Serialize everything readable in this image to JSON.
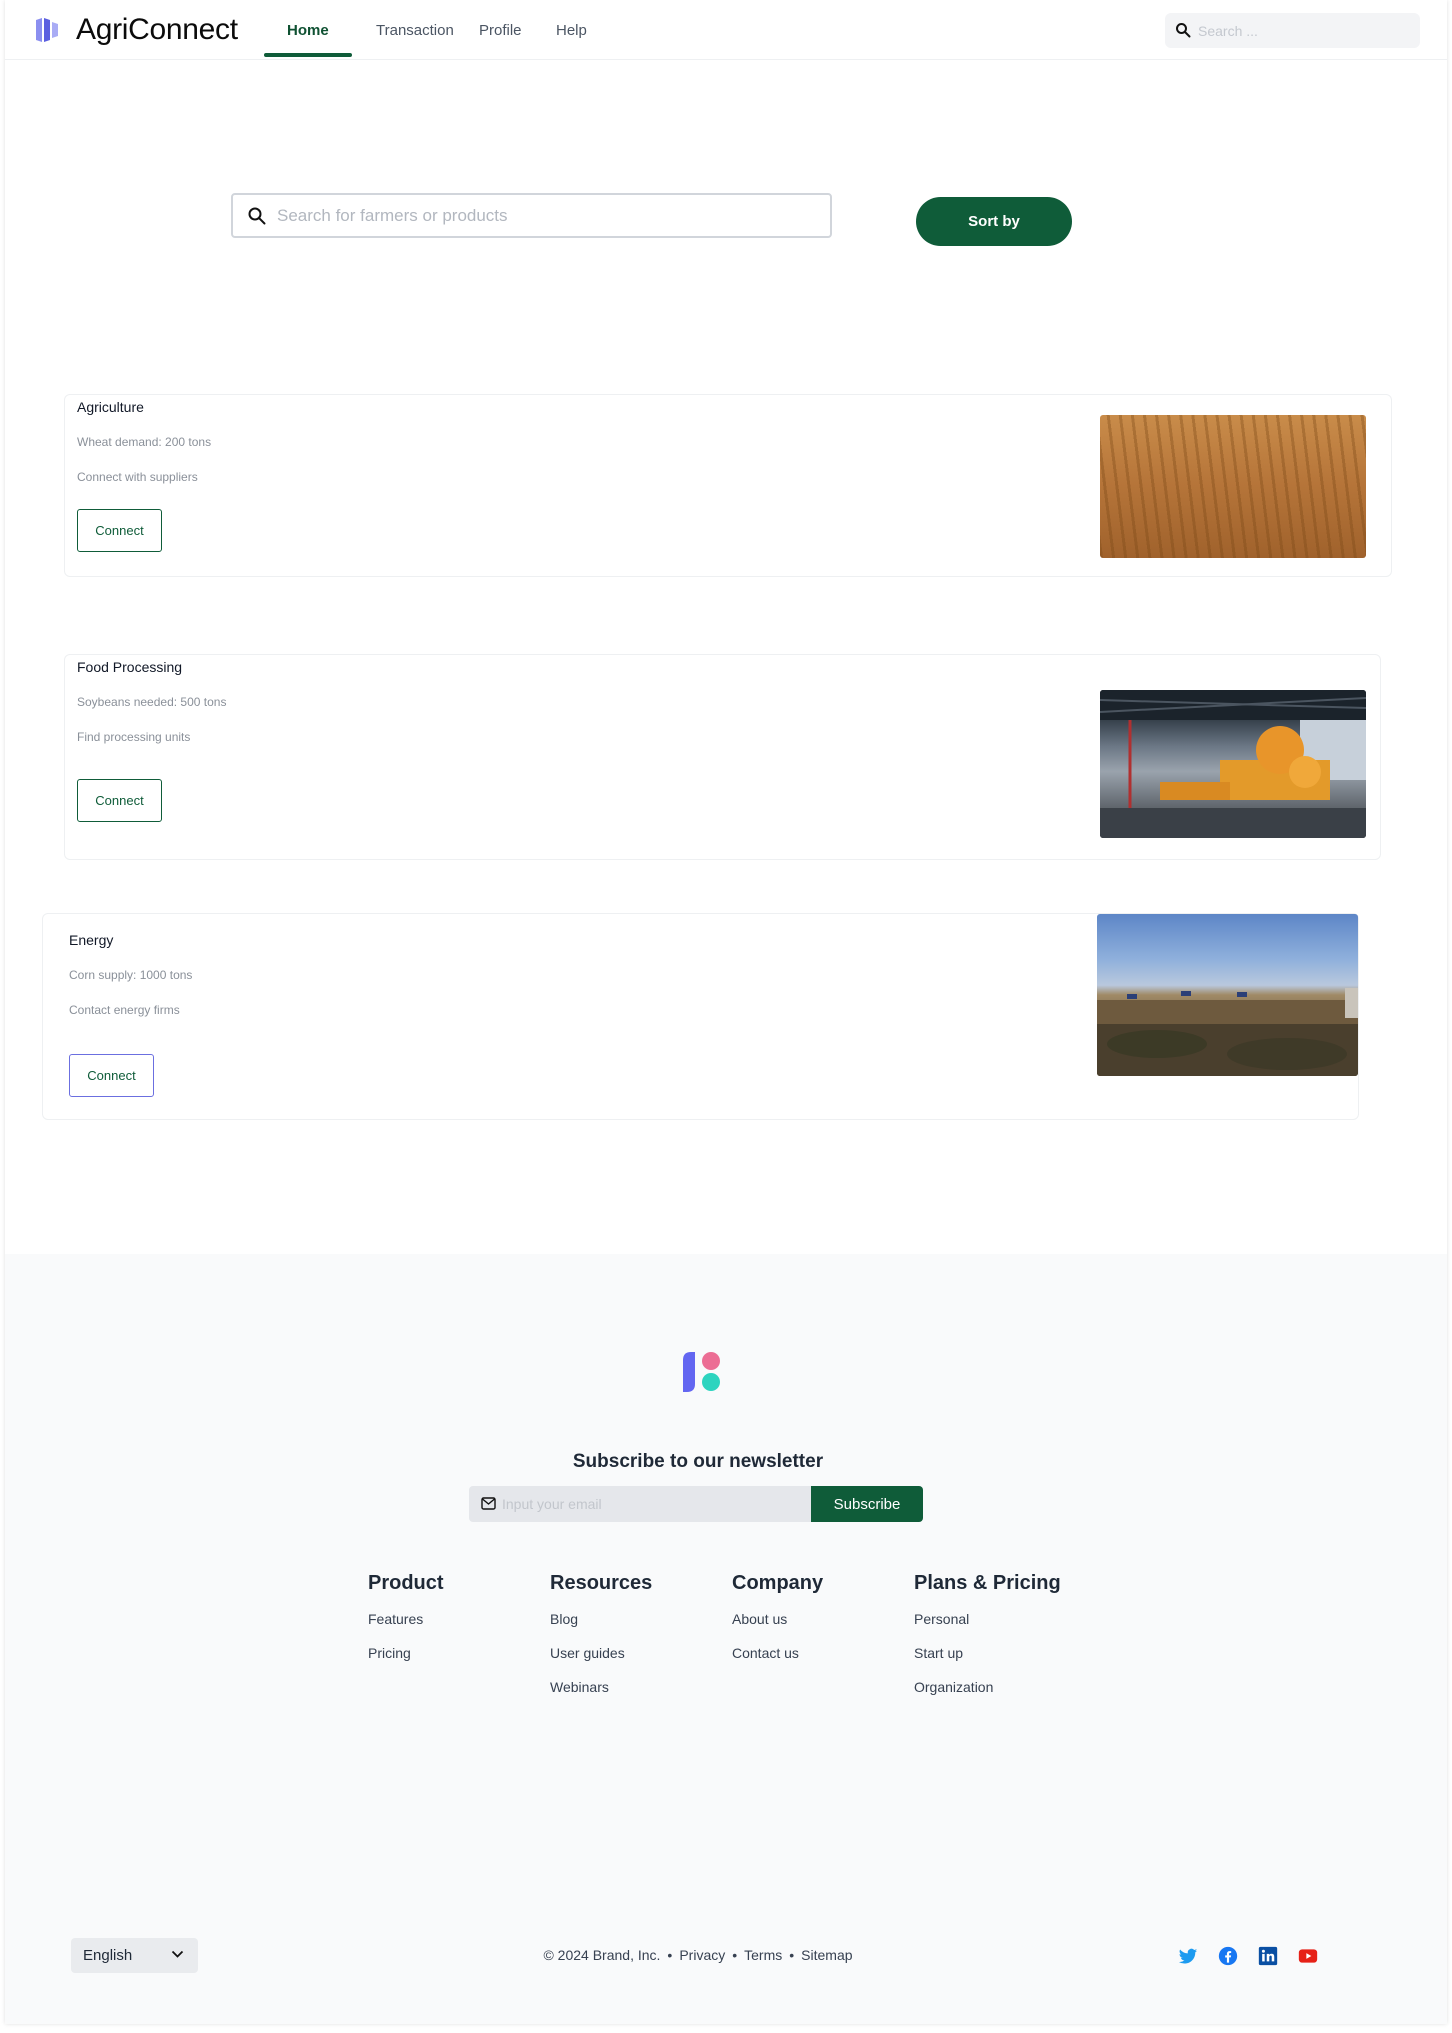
{
  "header": {
    "brand": "AgriConnect",
    "nav": [
      {
        "label": "Home",
        "active": true
      },
      {
        "label": "Transaction"
      },
      {
        "label": "Profile"
      },
      {
        "label": "Help"
      }
    ],
    "search_placeholder": "Search ...",
    "search_icon": "magnifier-icon",
    "accent_color": "#0f5c39"
  },
  "main": {
    "search_placeholder": "Search for farmers or products",
    "sort_label": "Sort by"
  },
  "cards": [
    {
      "title": "Agriculture",
      "line1": "Wheat demand: 200 tons",
      "line2": "Connect with suppliers",
      "button": "Connect",
      "image": "desert-field-photo"
    },
    {
      "title": "Food Processing",
      "line1": "Soybeans needed: 500 tons",
      "line2": "Find processing units",
      "button": "Connect",
      "image": "factory-machinery-photo"
    },
    {
      "title": "Energy",
      "line1": "Corn supply: 1000 tons",
      "line2": "Contact energy firms",
      "button": "Connect",
      "image": "solar-landscape-photo"
    }
  ],
  "footer": {
    "newsletter_title": "Subscribe to our newsletter",
    "email_placeholder": "Input your email",
    "subscribe_label": "Subscribe",
    "columns": [
      {
        "heading": "Product",
        "links": [
          "Features",
          "Pricing"
        ]
      },
      {
        "heading": "Resources",
        "links": [
          "Blog",
          "User guides",
          "Webinars"
        ]
      },
      {
        "heading": "Company",
        "links": [
          "About us",
          "Contact us"
        ]
      },
      {
        "heading": "Plans & Pricing",
        "links": [
          "Personal",
          "Start up",
          "Organization"
        ]
      }
    ],
    "language": "English",
    "copyright": "© 2024 Brand, Inc.",
    "legal_links": [
      "Privacy",
      "Terms",
      "Sitemap"
    ],
    "social_icons": [
      "twitter-icon",
      "facebook-icon",
      "linkedin-icon",
      "youtube-icon"
    ]
  }
}
